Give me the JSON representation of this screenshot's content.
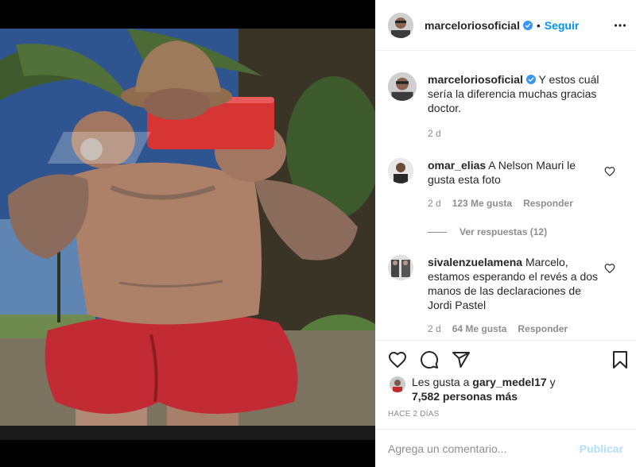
{
  "post": {
    "username": "marceloriosoficial",
    "follow_label": "Seguir",
    "dot": "•"
  },
  "caption": {
    "username": "marceloriosoficial",
    "text": "Y estos cuál sería la diferencia muchas gracias doctor.",
    "time": "2 d"
  },
  "comments": [
    {
      "username": "omar_elias",
      "text": "A Nelson Mauri le gusta esta foto",
      "time": "2 d",
      "likes": "123 Me gusta",
      "reply": "Responder",
      "view_replies": "Ver respuestas (12)"
    },
    {
      "username": "sivalenzuelamena",
      "text": "Marcelo, estamos esperando el revés a dos manos de las declaraciones de Jordi Pastel",
      "time": "2 d",
      "likes": "64 Me gusta",
      "reply": "Responder"
    }
  ],
  "likes": {
    "prefix": "Les gusta a",
    "user": "gary_medel17",
    "connector": "y",
    "others": "7,582 personas más"
  },
  "timestamp": "HACE 2 DÍAS",
  "add_comment": {
    "placeholder": "Agrega un comentario...",
    "post_label": "Publicar"
  },
  "icons": {
    "more": "more-options-icon",
    "like": "heart-icon",
    "comment": "comment-icon",
    "share": "share-icon",
    "save": "bookmark-icon"
  },
  "colors": {
    "accent": "#0095f6",
    "verified": "#3897f0",
    "muted": "#8e8e8e",
    "publish_disabled": "#b2dffc"
  }
}
